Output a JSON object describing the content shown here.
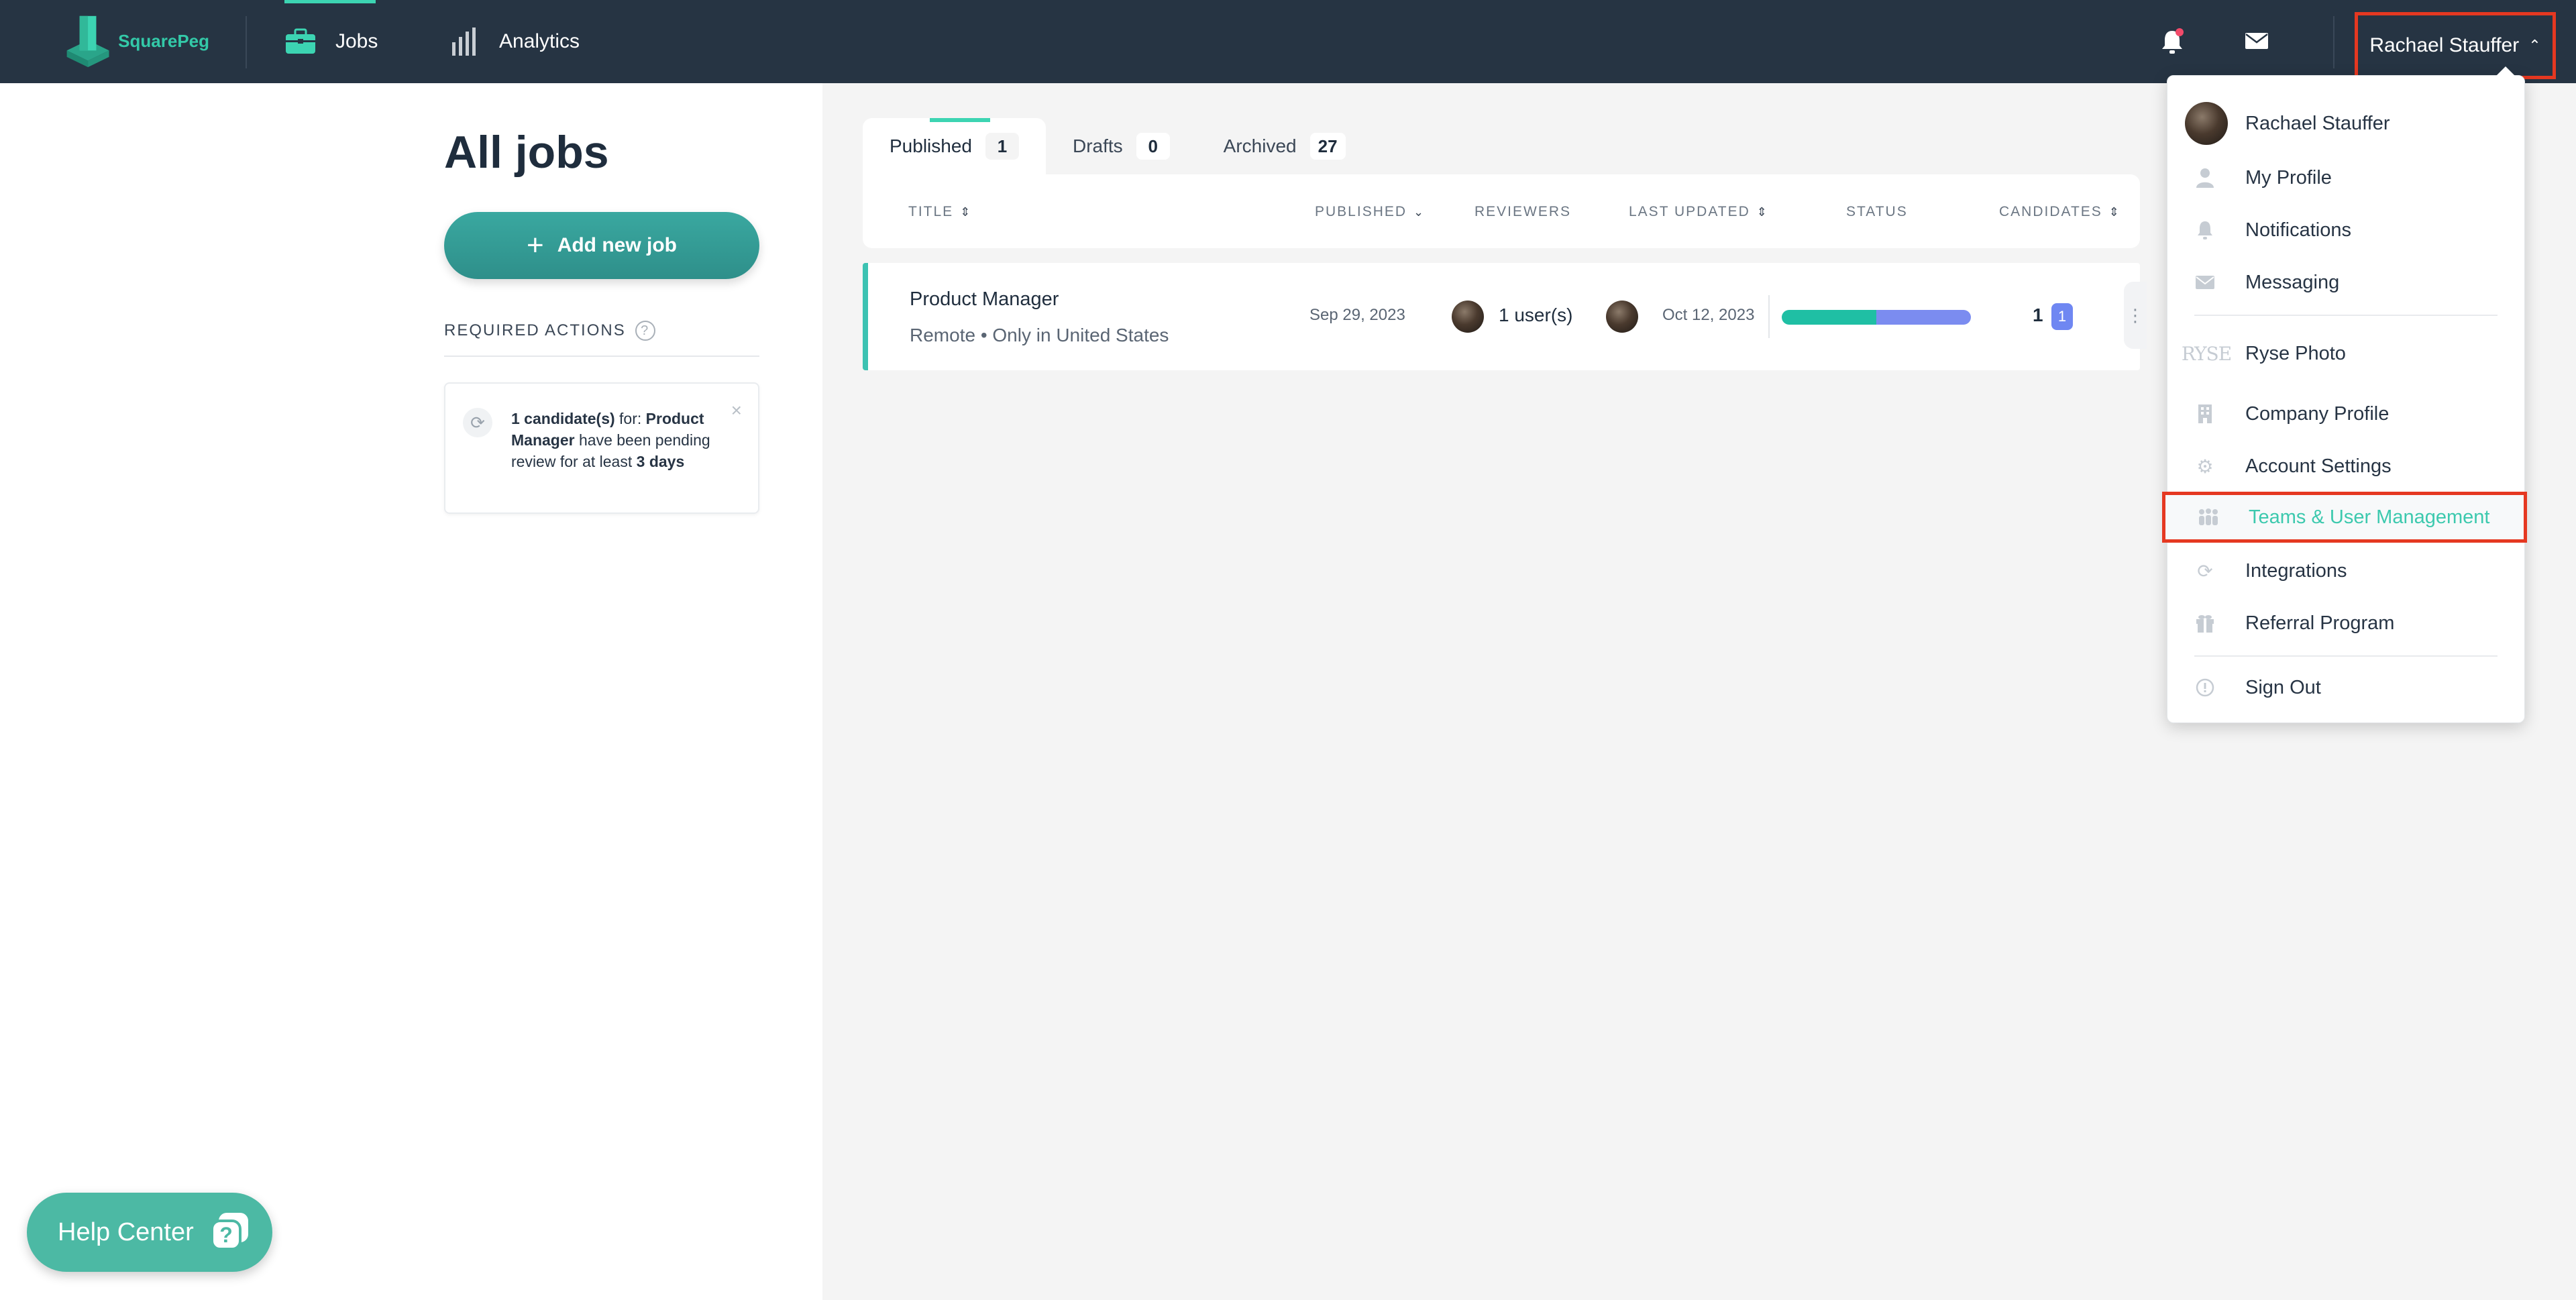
{
  "nav": {
    "logo_text": "SquarePeg",
    "jobs_label": "Jobs",
    "analytics_label": "Analytics",
    "user_name": "Rachael Stauffer",
    "accent_color": "#3cd4b2",
    "bg_color": "#263443"
  },
  "page": {
    "title": "All jobs",
    "add_job_label": "Add new job",
    "required_actions_label": "REQUIRED ACTIONS",
    "notice": {
      "count_text": "1 candidate(s)",
      "for_text": " for: ",
      "job_name": "Product Manager",
      "middle_text": " have been pending review for at least ",
      "duration": "3 days"
    }
  },
  "tabs": [
    {
      "label": "Published",
      "count": "1"
    },
    {
      "label": "Drafts",
      "count": "0"
    },
    {
      "label": "Archived",
      "count": "27"
    }
  ],
  "table": {
    "headers": {
      "title": "TITLE",
      "published": "PUBLISHED",
      "reviewers": "REVIEWERS",
      "last_updated": "LAST UPDATED",
      "status": "STATUS",
      "candidates": "CANDIDATES"
    },
    "rows": [
      {
        "title": "Product Manager",
        "location": "Remote •  Only in United States",
        "published": "Sep 29, 2023",
        "reviewers": "1 user(s)",
        "last_updated": "Oct 12, 2023",
        "status_fraction_teal": 0.5,
        "candidates": "1",
        "candidates_badge": "1"
      }
    ]
  },
  "dropdown": {
    "profile_name": "Rachael Stauffer",
    "my_profile": "My Profile",
    "notifications": "Notifications",
    "messaging": "Messaging",
    "company_logo_text": "RYSE",
    "company_name": "Ryse Photo",
    "company_profile": "Company Profile",
    "account_settings": "Account Settings",
    "teams": "Teams & User Management",
    "integrations": "Integrations",
    "referral": "Referral Program",
    "sign_out": "Sign Out"
  },
  "help_center": {
    "label": "Help Center"
  }
}
